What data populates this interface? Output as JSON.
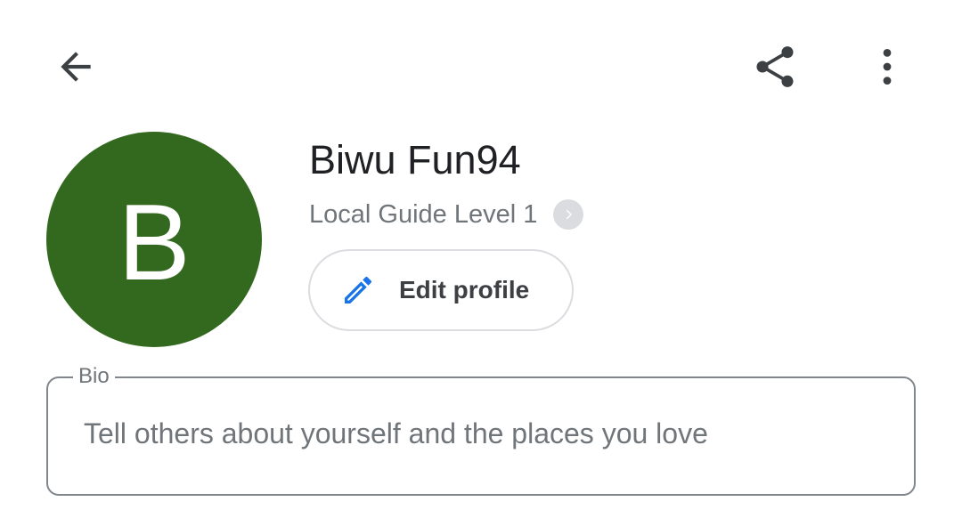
{
  "toolbar": {
    "back_icon": "arrow-back-icon",
    "share_icon": "share-icon",
    "more_icon": "more-vert-icon"
  },
  "profile": {
    "avatar_letter": "B",
    "avatar_color": "#33691e",
    "name": "Biwu Fun94",
    "guide_level": "Local Guide Level 1",
    "edit_button_label": "Edit profile",
    "edit_icon": "pencil-icon",
    "edit_icon_color": "#1a73e8"
  },
  "bio": {
    "label": "Bio",
    "value": "",
    "placeholder": "Tell others about yourself and the places you love"
  }
}
